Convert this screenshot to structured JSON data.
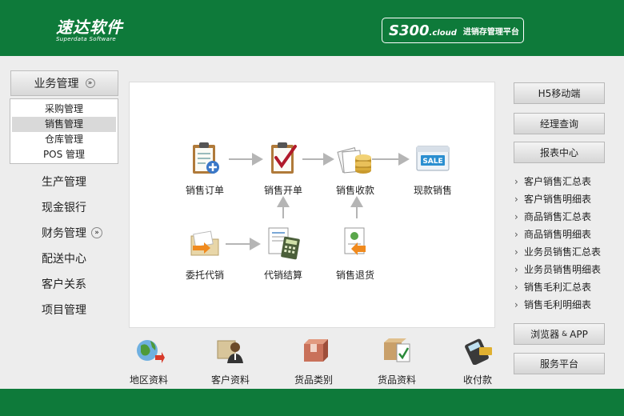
{
  "brand": {
    "logo_text": "速达软件",
    "logo_sub": "Superdata Software",
    "product_code": "S300",
    "product_suffix": ".cloud",
    "product_desc": "进销存管理平台"
  },
  "left_nav": {
    "header_label": "业务管理",
    "sub_items": [
      {
        "label": "采购管理"
      },
      {
        "label": "销售管理",
        "active": true
      },
      {
        "label": "仓库管理"
      },
      {
        "label": "POS 管理"
      }
    ],
    "items": [
      {
        "label": "生产管理"
      },
      {
        "label": "现金银行"
      },
      {
        "label": "财务管理"
      },
      {
        "label": "配送中心"
      },
      {
        "label": "客户关系"
      },
      {
        "label": "项目管理"
      }
    ]
  },
  "flow": {
    "nodes": [
      {
        "label": "销售订单",
        "icon": "clipboard-order-icon"
      },
      {
        "label": "销售开单",
        "icon": "clipboard-check-icon"
      },
      {
        "label": "销售收款",
        "icon": "coins-icon"
      },
      {
        "label": "现款销售",
        "icon": "sale-tag-icon"
      },
      {
        "label": "委托代销",
        "icon": "folder-arrow-icon"
      },
      {
        "label": "代销结算",
        "icon": "calculator-icon"
      },
      {
        "label": "销售退货",
        "icon": "return-doc-icon"
      }
    ]
  },
  "shortcuts": [
    {
      "label": "地区资料",
      "icon": "globe-icon"
    },
    {
      "label": "客户资料",
      "icon": "customer-icon"
    },
    {
      "label": "货品类别",
      "icon": "box-category-icon"
    },
    {
      "label": "货品资料",
      "icon": "box-doc-icon"
    },
    {
      "label": "收付款",
      "icon": "card-terminal-icon"
    }
  ],
  "right_nav": {
    "h5_label": "H5移动端",
    "manager_label": "经理查询",
    "reports_label": "报表中心",
    "reports": [
      {
        "label": "客户销售汇总表"
      },
      {
        "label": "客户销售明细表"
      },
      {
        "label": "商品销售汇总表"
      },
      {
        "label": "商品销售明细表"
      },
      {
        "label": "业务员销售汇总表"
      },
      {
        "label": "业务员销售明细表"
      },
      {
        "label": "销售毛利汇总表"
      },
      {
        "label": "销售毛利明细表"
      }
    ],
    "browser_label": "浏览器",
    "browser_amp": "&",
    "browser_app": "APP",
    "service_label": "服务平台"
  },
  "colors": {
    "brand_green": "#0e7a3a",
    "flow_arrow": "#b5b5b5"
  }
}
